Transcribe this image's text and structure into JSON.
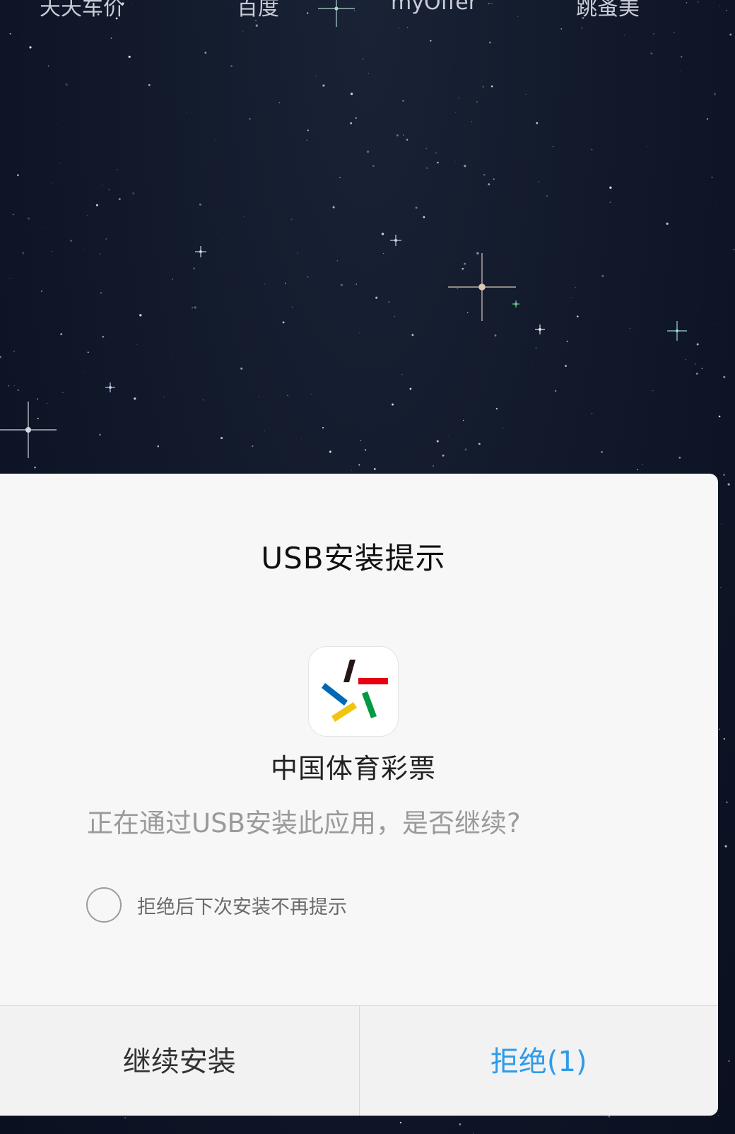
{
  "launcher": {
    "labels": [
      "天天车价",
      "百度",
      "myOffer",
      "跳蚤美"
    ]
  },
  "dialog": {
    "title": "USB安装提示",
    "app_name": "中国体育彩票",
    "app_icon": "china-sports-lottery-icon",
    "message": "正在通过USB安装此应用，是否继续?",
    "checkbox_label": "拒绝后下次安装不再提示",
    "checkbox_checked": false,
    "continue_label": "继续安装",
    "reject_label": "拒绝(1)"
  },
  "colors": {
    "accent": "#2f9be8",
    "dialog_bg": "#f7f7f7",
    "icon_black": "#231815",
    "icon_red": "#e60012",
    "icon_blue": "#0068b7",
    "icon_yellow": "#f2c40d",
    "icon_green": "#009944"
  }
}
